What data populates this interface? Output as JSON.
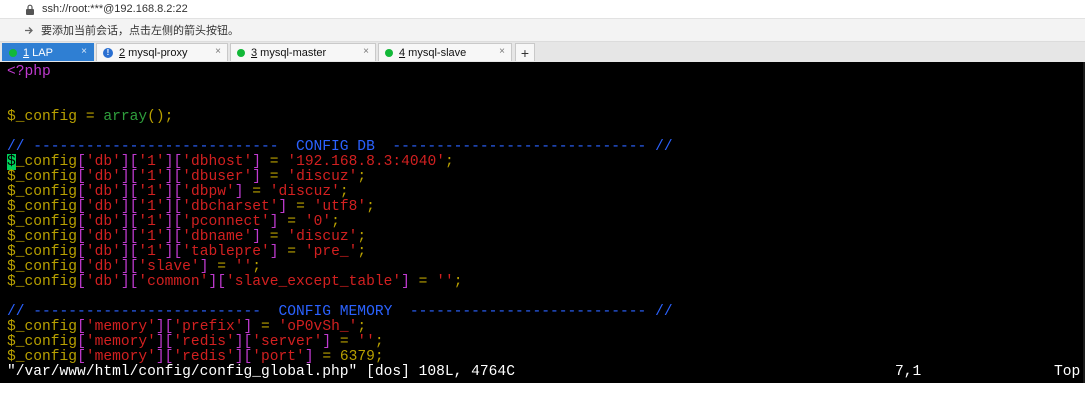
{
  "window": {
    "title": "ssh://root:***@192.168.8.2:22",
    "hint": "要添加当前会话，点击左侧的箭头按钮。"
  },
  "colors": {
    "tab_active_bg": "#2f7fd3",
    "tab_dot_green": "#12b838",
    "terminal_bg": "#000000",
    "cursor": "#00d05a"
  },
  "tabs": [
    {
      "num": "1",
      "label": "LAP",
      "icon": "green-dot-icon",
      "active": true
    },
    {
      "num": "2",
      "label": "mysql-proxy",
      "icon": "info-icon",
      "active": false
    },
    {
      "num": "3",
      "label": "mysql-master",
      "icon": "green-dot-icon",
      "active": false
    },
    {
      "num": "4",
      "label": "mysql-slave",
      "icon": "green-dot-icon",
      "active": false
    }
  ],
  "new_tab_label": "+",
  "terminal": {
    "lines": [
      {
        "t": "<?php",
        "c": "#c03ad0"
      },
      {
        "t": "",
        "c": "#ffffff"
      },
      {
        "t": "",
        "c": "#ffffff"
      },
      {
        "t": "$_config = array();",
        "c": "#b8a000",
        "segments": [
          {
            "s": "$_config = ",
            "c": "#b8a000"
          },
          {
            "s": "array",
            "c": "#2f9e3c"
          },
          {
            "s": "();",
            "c": "#b8a000"
          }
        ]
      },
      {
        "t": "",
        "c": "#ffffff"
      },
      {
        "t": "// ----------------------------  CONFIG DB  ----------------------------- //",
        "c": "#2b62ff"
      },
      {
        "t": "$_config['db']['1']['dbhost'] = '192.168.8.3:4040';",
        "cursor": true
      },
      {
        "t": "$_config['db']['1']['dbuser'] = 'discuz';"
      },
      {
        "t": "$_config['db']['1']['dbpw'] = 'discuz';"
      },
      {
        "t": "$_config['db']['1']['dbcharset'] = 'utf8';"
      },
      {
        "t": "$_config['db']['1']['pconnect'] = '0';"
      },
      {
        "t": "$_config['db']['1']['dbname'] = 'discuz';"
      },
      {
        "t": "$_config['db']['1']['tablepre'] = 'pre_';"
      },
      {
        "t": "$_config['db']['slave'] = '';"
      },
      {
        "t": "$_config['db']['common']['slave_except_table'] = '';"
      },
      {
        "t": "",
        "c": "#ffffff"
      },
      {
        "t": "// --------------------------  CONFIG MEMORY  --------------------------- //",
        "c": "#2b62ff"
      },
      {
        "t": "$_config['memory']['prefix'] = 'oP0vSh_';"
      },
      {
        "t": "$_config['memory']['redis']['server'] = '';"
      },
      {
        "t": "$_config['memory']['redis']['port'] = 6379;"
      }
    ],
    "status_file": "\"/var/www/html/config/config_global.php\" [dos] 108L, 4764C",
    "status_pos": "7,1",
    "status_top": "Top"
  }
}
